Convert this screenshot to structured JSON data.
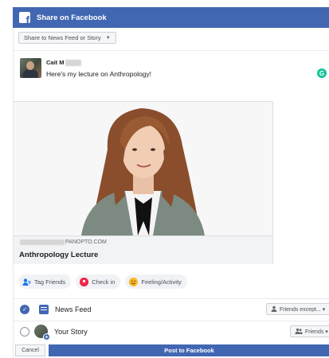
{
  "window": {
    "title": "Share on Facebook",
    "logo_glyph": "f"
  },
  "share_target": {
    "selected": "Share to News Feed or Story",
    "caret": "▼"
  },
  "composer": {
    "author_name": "Cait M",
    "post_text": "Here's my lecture on Anthropology!",
    "grammar_glyph": "G"
  },
  "link_card": {
    "domain": "PANOPTO.COM",
    "title": "Anthropology Lecture"
  },
  "actions": {
    "tag_friends": "Tag Friends",
    "check_in": "Check in",
    "feeling": "Feeling/Activity"
  },
  "destinations": {
    "news_feed": {
      "label": "News Feed",
      "checked": true,
      "audience": "Friends except... ▾"
    },
    "your_story": {
      "label": "Your Story",
      "checked": false,
      "audience": "Friends ▾"
    }
  },
  "footer": {
    "cancel": "Cancel",
    "post": "Post to Facebook"
  },
  "colors": {
    "brand": "#4267b2",
    "grammar": "#15c39a",
    "checkin": "#f02849",
    "feeling": "#f7b928"
  }
}
